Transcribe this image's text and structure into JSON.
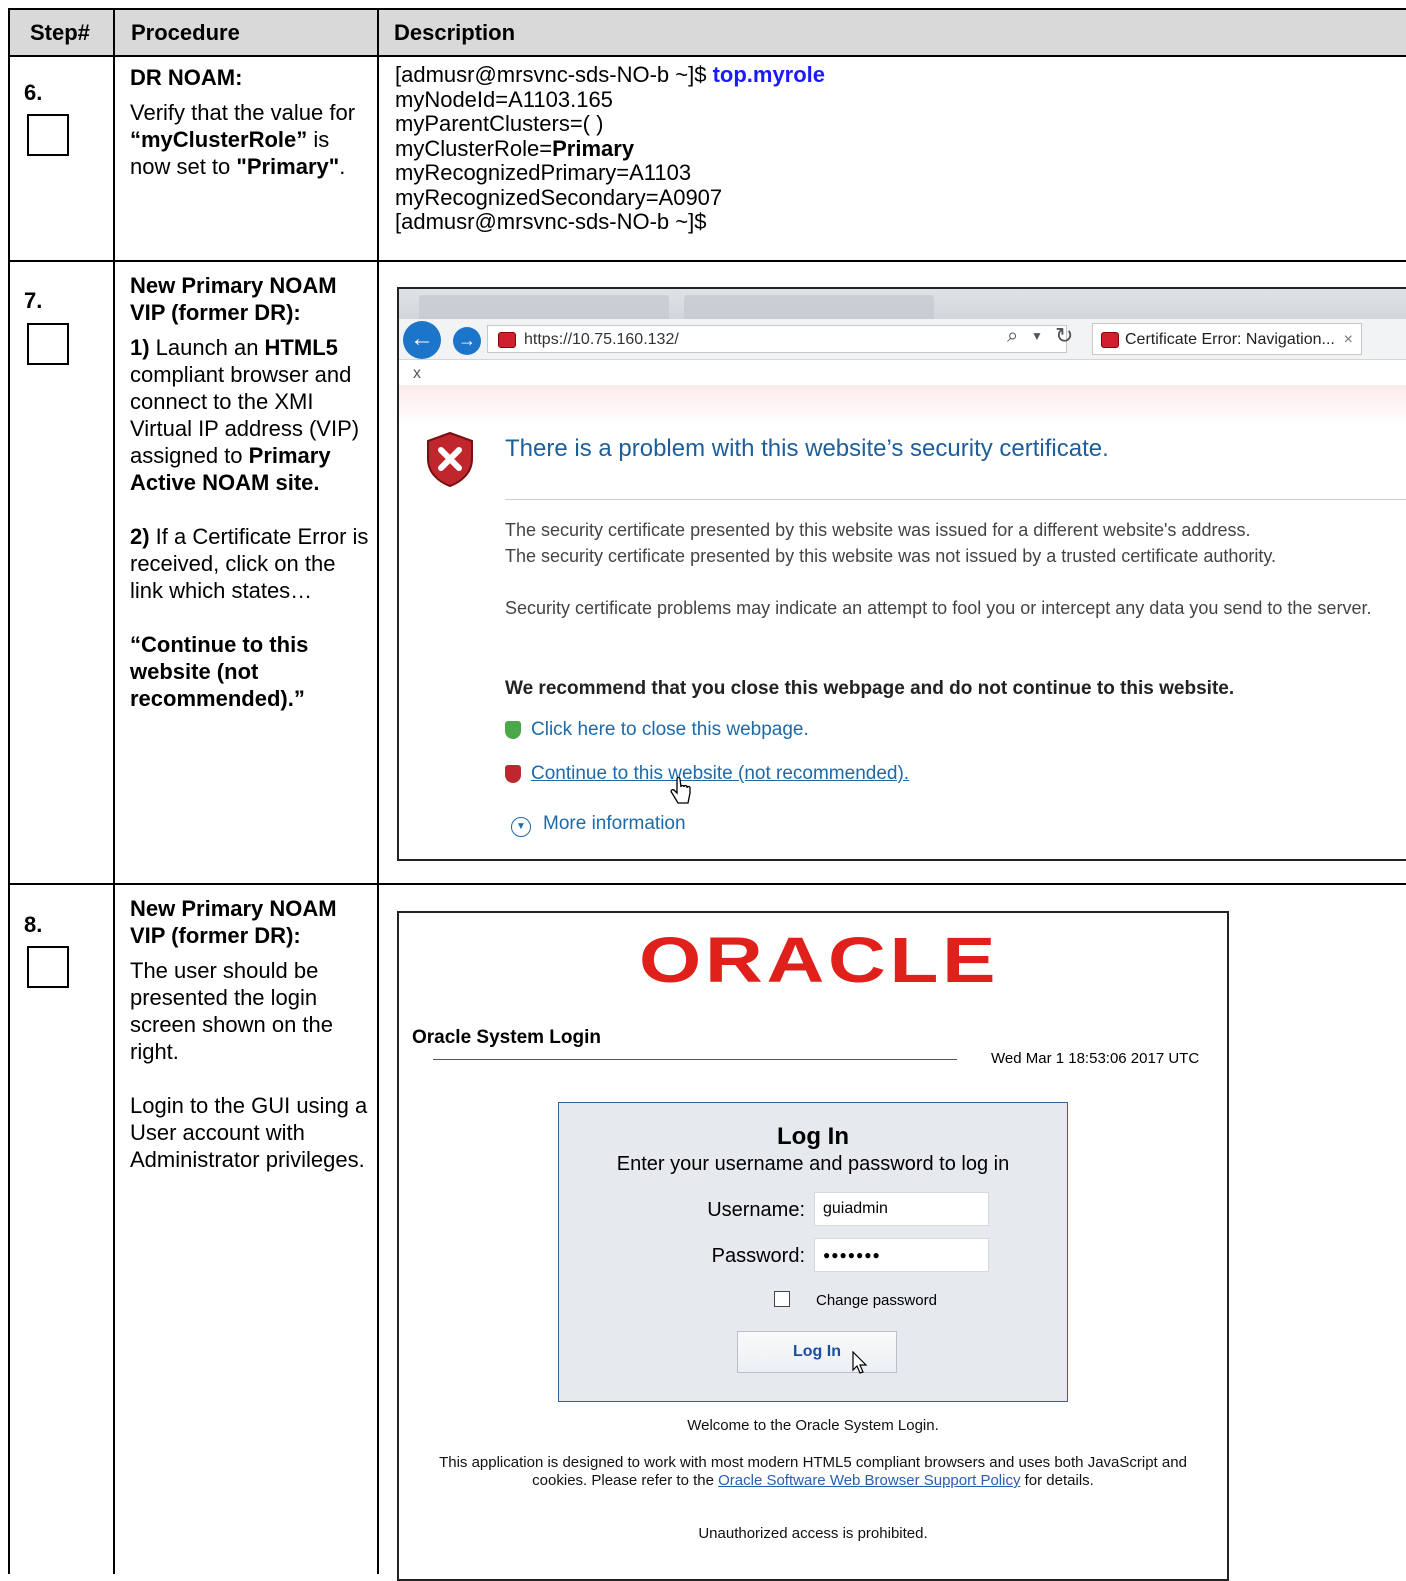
{
  "headers": {
    "step": "Step#",
    "procedure": "Procedure",
    "description": "Description"
  },
  "steps": [
    {
      "number": "6.",
      "procedure": {
        "title": "DR NOAM:",
        "text_1": "Verify that the value for ",
        "bold_1": "“myClusterRole”",
        "text_2": " is now set to ",
        "bold_2": "\"Primary\"",
        "text_3": "."
      },
      "terminal": {
        "prompt": "[admusr@mrsvnc-sds-NO-b ~]$ ",
        "command": "top.myrole",
        "lines": [
          "myNodeId=A1103.165",
          "myParentClusters=( )"
        ],
        "role_prefix": "myClusterRole=",
        "role_value": "Primary",
        "lines_after": [
          "myRecognizedPrimary=A1103",
          "myRecognizedSecondary=A0907",
          "[admusr@mrsvnc-sds-NO-b ~]$"
        ]
      }
    },
    {
      "number": "7.",
      "procedure": {
        "title": "New Primary NOAM VIP (former DR):",
        "p1_num": "1)",
        "p1_a": " Launch an ",
        "p1_b": "HTML5",
        "p1_c": " compliant browser and connect to the XMI Virtual IP address (VIP) assigned to ",
        "p1_d": "Primary Active NOAM site.",
        "p2_num": "2)",
        "p2_a": " If a Certificate Error is received, click on the link which states…",
        "quote": "“Continue to this website (not recommended).”"
      },
      "browser": {
        "url": "https://10.75.160.132/",
        "tab_label": "Certificate Error: Navigation...",
        "tab_close": "×",
        "close_x": "x",
        "title": "There is a problem with this website’s security certificate.",
        "line_1": "The security certificate presented by this website was issued for a different website's address.",
        "line_2": "The security certificate presented by this website was not issued by a trusted certificate authority.",
        "line_3": "Security certificate problems may indicate an attempt to fool you or intercept any data you send to the server.",
        "recommend": "We recommend that you close this webpage and do not continue to this website.",
        "link_close": "Click here to close this webpage.",
        "link_continue": "Continue to this website (not recommended).",
        "more_info": "More information"
      }
    },
    {
      "number": "8.",
      "procedure": {
        "title": "New Primary NOAM VIP (former DR):",
        "p1": "The user should be presented the login screen shown on the right.",
        "p2": "Login to the GUI using a User account with Administrator privileges."
      },
      "login": {
        "logo": "ORACLE",
        "heading": "Oracle System Login",
        "datetime": "Wed Mar 1 18:53:06 2017 UTC",
        "box_title": "Log In",
        "box_subtitle": "Enter your username and password to log in",
        "username_label": "Username:",
        "username_value": "guiadmin",
        "password_label": "Password:",
        "password_value": "●●●●●●●",
        "change_password": "Change password",
        "button": "Log In",
        "welcome": "Welcome to the Oracle System Login.",
        "info_a": "This application is designed to work with most modern HTML5 compliant browsers and uses both JavaScript and",
        "info_b": "cookies. Please refer to the ",
        "info_link": "Oracle Software Web Browser Support Policy",
        "info_c": " for details.",
        "unauthorized": "Unauthorized access is prohibited."
      }
    }
  ],
  "colors": {
    "header_bg": "#d9d9d9",
    "command_blue": "#1a1aff",
    "oracle_red": "#e0201b",
    "link_blue": "#1e6aa8"
  }
}
